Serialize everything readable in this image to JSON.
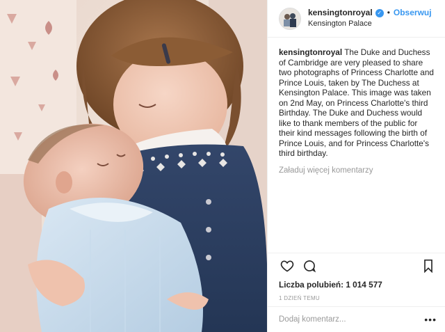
{
  "header": {
    "username": "kensingtonroyal",
    "verified_icon": "verified-badge-icon",
    "separator": "•",
    "follow_label": "Obserwuj",
    "location": "Kensington Palace"
  },
  "caption": {
    "username": "kensingtonroyal",
    "text": "The Duke and Duchess of Cambridge are very pleased to share two photographs of Princess Charlotte and Prince Louis, taken by The Duchess at Kensington Palace. This image was taken on 2nd May, on Princess Charlotte's third Birthday. The Duke and Duchess would like to thank members of the public for their kind messages following the birth of Prince Louis, and for Princess Charlotte's third birthday."
  },
  "load_more_comments": "Załaduj więcej komentarzy",
  "actions": {
    "like_icon": "heart-icon",
    "comment_icon": "comment-icon",
    "save_icon": "bookmark-icon"
  },
  "likes_text": "Liczba polubień: 1 014 577",
  "timestamp": "1 DZIEŃ TEMU",
  "comment_box": {
    "placeholder": "Dodaj komentarz...",
    "more_icon": "more-options-icon",
    "more_label": "•••"
  },
  "colors": {
    "accent": "#3897f0",
    "border": "#efefef",
    "muted": "#999999",
    "text": "#262626"
  }
}
